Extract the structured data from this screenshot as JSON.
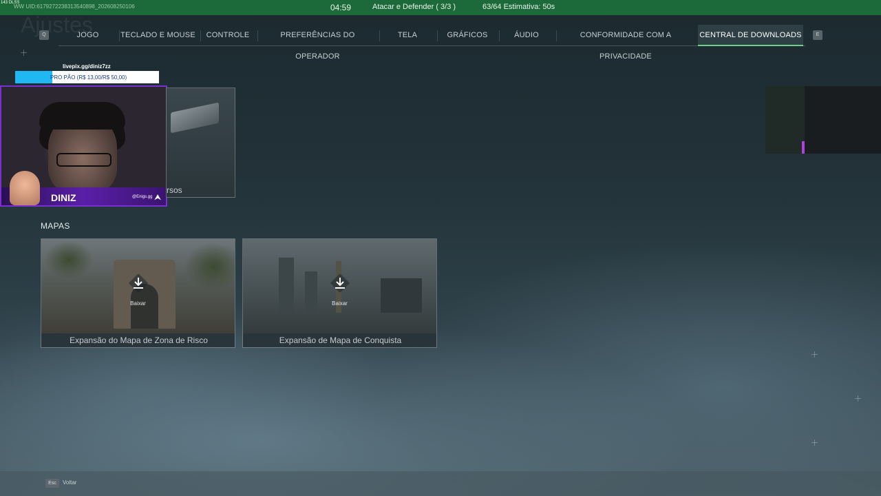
{
  "top_bar": {
    "fps": "143 DLSS",
    "uid": "WW UID:6179272238313540898_202608250106",
    "timer": "04:59",
    "mode": "Atacar e Defender ( 3/3 )",
    "queue": "63/64  Estimativa: 50s"
  },
  "background_title": "Ajustes",
  "tabs": {
    "prev_key": "Q",
    "next_key": "E",
    "items": [
      {
        "label": "JOGO",
        "active": false
      },
      {
        "label": "TECLADO E MOUSE",
        "active": false
      },
      {
        "label": "CONTROLE",
        "active": false
      },
      {
        "label": "PREFERÊNCIAS DO OPERADOR",
        "active": false
      },
      {
        "label": "TELA",
        "active": false
      },
      {
        "label": "GRÁFICOS",
        "active": false
      },
      {
        "label": "ÁUDIO",
        "active": false
      },
      {
        "label": "CONFORMIDADE COM A PRIVACIDADE",
        "active": false
      },
      {
        "label": "CENTRAL DE DOWNLOADS",
        "active": true
      }
    ]
  },
  "overlay": {
    "link": "livepix.gg/diniz7zz",
    "goal_text": "PRO PÃO (R$ 13,00/R$ 50,00)",
    "goal_progress": 0.26,
    "streamer_name": "DINIZ",
    "streamer_handle": "@Enigs.gg"
  },
  "partial_card": {
    "label": "rsos"
  },
  "section": {
    "title": "MAPAS"
  },
  "maps": [
    {
      "title": "Expansão do Mapa de Zona de Risco",
      "action": "Baixar",
      "icon": "download-icon"
    },
    {
      "title": "Expansão de Mapa de Conquista",
      "action": "Baixar",
      "icon": "download-icon"
    }
  ],
  "footer": {
    "esc_key": "Esc",
    "back_label": "Voltar"
  },
  "colors": {
    "top_bar": "#1c6a3a",
    "active_tab_underline": "#6fd08a",
    "overlay_accent": "#7a2fd0",
    "goal_fill": "#1fb8f3"
  }
}
